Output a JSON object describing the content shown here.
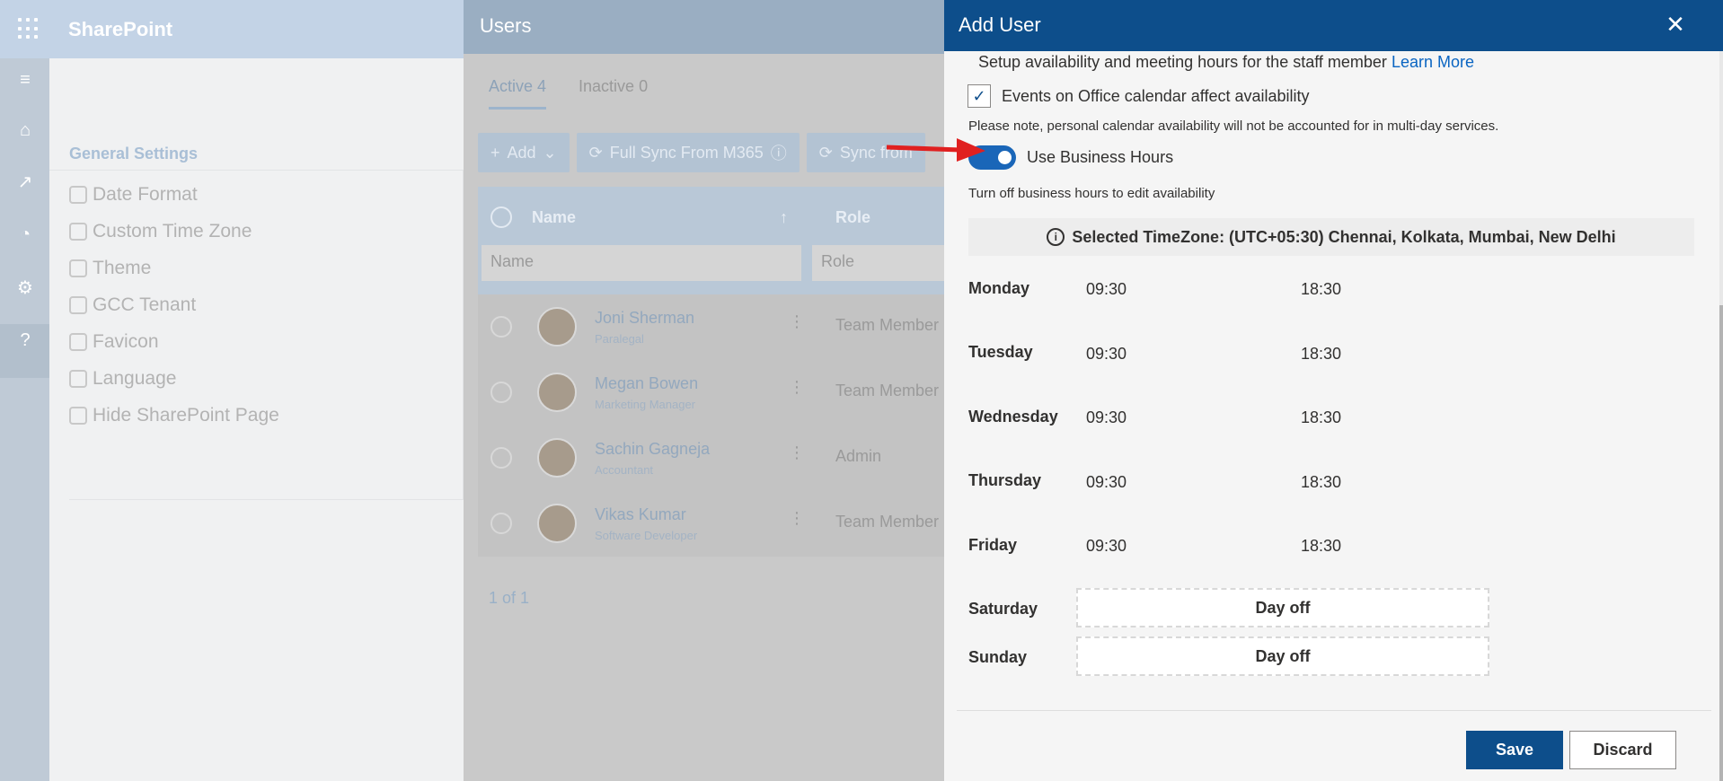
{
  "app": {
    "brand": "SharePoint"
  },
  "settings": {
    "title": "General Settings",
    "items": [
      "Date Format",
      "Custom Time Zone",
      "Theme",
      "GCC Tenant",
      "Favicon",
      "Language",
      "Hide SharePoint Page"
    ]
  },
  "users": {
    "title": "Users",
    "tabs": [
      "Active 4",
      "Inactive 0"
    ],
    "toolbar": [
      "Add",
      "Full Sync From M365",
      "Sync from"
    ],
    "columns": {
      "name": "Name",
      "role": "Role"
    },
    "filters": {
      "name": "Name",
      "role": "Role"
    },
    "rows": [
      {
        "name": "Joni Sherman",
        "title": "Paralegal",
        "role": "Team Member"
      },
      {
        "name": "Megan Bowen",
        "title": "Marketing Manager",
        "role": "Team Member"
      },
      {
        "name": "Sachin Gagneja",
        "title": "Accountant",
        "role": "Admin"
      },
      {
        "name": "Vikas Kumar",
        "title": "Software Developer",
        "role": "Team Member"
      }
    ],
    "pager": "1 of 1"
  },
  "dialog": {
    "title": "Add User",
    "setup_text": "Setup availability and meeting hours for the staff member",
    "learn_more": "Learn More",
    "events_checkbox": "Events on Office calendar affect availability",
    "note": "Please note, personal calendar availability will not be accounted for in multi-day services.",
    "toggle_label": "Use Business Hours",
    "hint": "Turn off business hours to edit availability",
    "timezone": "Selected TimeZone: (UTC+05:30) Chennai, Kolkata, Mumbai, New Delhi",
    "days": [
      {
        "day": "Monday",
        "start": "09:30",
        "end": "18:30"
      },
      {
        "day": "Tuesday",
        "start": "09:30",
        "end": "18:30"
      },
      {
        "day": "Wednesday",
        "start": "09:30",
        "end": "18:30"
      },
      {
        "day": "Thursday",
        "start": "09:30",
        "end": "18:30"
      },
      {
        "day": "Friday",
        "start": "09:30",
        "end": "18:30"
      }
    ],
    "offdays": [
      {
        "day": "Saturday",
        "status": "Day off"
      },
      {
        "day": "Sunday",
        "status": "Day off"
      }
    ],
    "save": "Save",
    "discard": "Discard"
  },
  "colors": {
    "header": "#0d4e8b",
    "toggle": "#1a66b8",
    "link": "#0a65c2",
    "arrow": "#e02020"
  }
}
